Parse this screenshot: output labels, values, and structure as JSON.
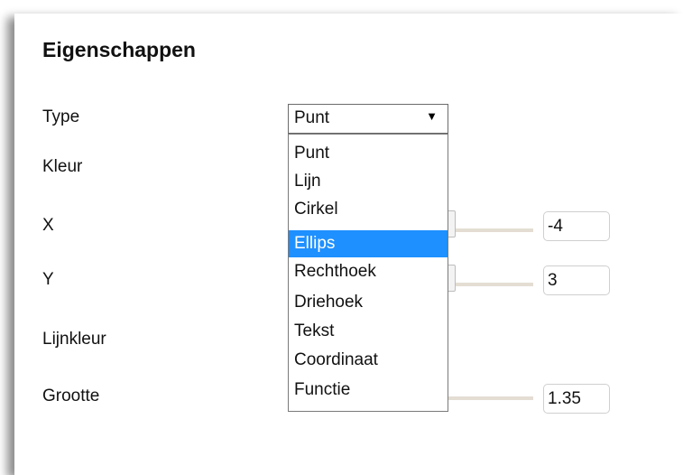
{
  "panel": {
    "title": "Eigenschappen"
  },
  "labels": {
    "type": "Type",
    "kleur": "Kleur",
    "x": "X",
    "y": "Y",
    "lijnkleur": "Lijnkleur",
    "grootte": "Grootte"
  },
  "type_select": {
    "value": "Punt",
    "arrow": "▼",
    "options": [
      "Punt",
      "Lijn",
      "Cirkel",
      "Ellips",
      "Rechthoek",
      "Driehoek",
      "Tekst",
      "Coordinaat",
      "Functie"
    ],
    "highlighted": "Ellips"
  },
  "fields": {
    "x_value": "-4",
    "y_value": "3",
    "grootte_value": "1.35"
  },
  "colors": {
    "highlight": "#1e90ff",
    "track": "#e4ddd3"
  }
}
